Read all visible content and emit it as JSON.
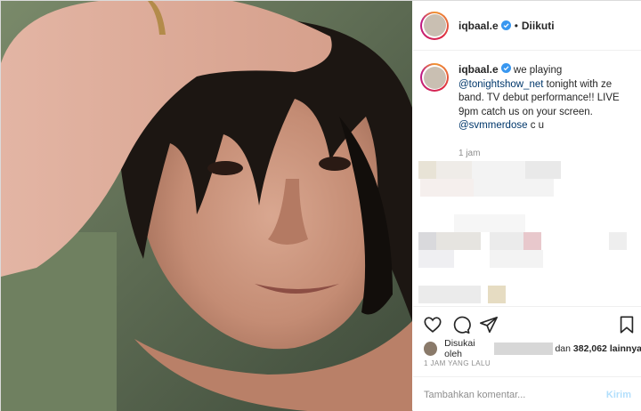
{
  "header": {
    "username": "iqbaal.e",
    "verified_icon": "verified-badge-icon",
    "separator": "•",
    "follow_status": "Diikuti"
  },
  "caption": {
    "username": "iqbaal.e",
    "text_1": "we playing",
    "mention_1": "@tonightshow_net",
    "text_2": "tonight with ze band. TV debut performance!! LIVE 9pm catch us on your screen.",
    "mention_2": "@svmmerdose",
    "text_3": "c u",
    "time_ago": "1 jam"
  },
  "actions": {
    "like_icon": "heart-icon",
    "comment_icon": "comment-icon",
    "share_icon": "share-icon",
    "save_icon": "bookmark-icon"
  },
  "likes": {
    "prefix": "Disukai oleh",
    "connector": "dan",
    "count": "382,062",
    "suffix": "lainnya"
  },
  "post_date": "1 JAM YANG LALU",
  "comment_box": {
    "placeholder": "Tambahkan komentar...",
    "post_label": "Kirim"
  },
  "colors": {
    "link": "#00376b",
    "verified": "#3897f0",
    "muted": "#8e8e8e",
    "post_disabled": "#b2dffc"
  }
}
